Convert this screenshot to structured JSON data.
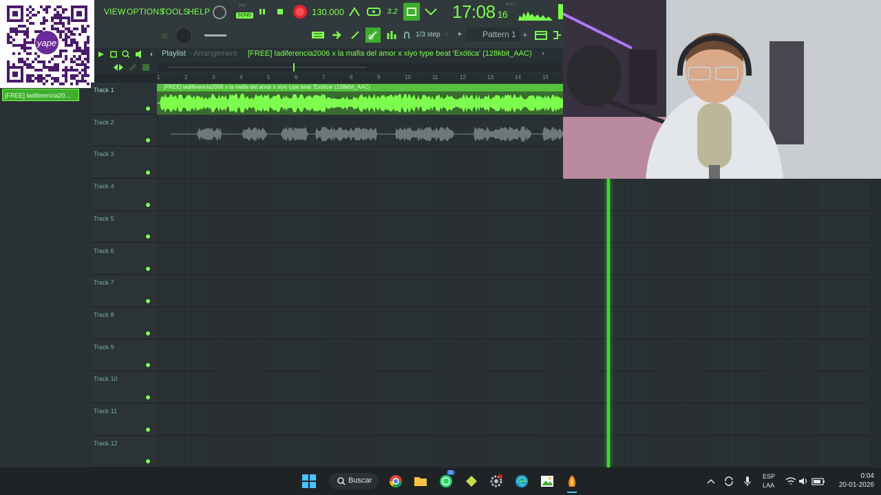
{
  "menu": [
    "VIEW",
    "OPTIONS",
    "TOOLS",
    "HELP"
  ],
  "transport": {
    "pat_label": "PAT",
    "song_label": "SONG",
    "bpm": "130.000",
    "time": "17:08",
    "time_small": "16",
    "bst_label": "B:S:T"
  },
  "toolbar2": {
    "snap": "1/3 step",
    "pattern": "Pattern 1",
    "pattern_add": "+"
  },
  "playlist": {
    "title": "Playlist",
    "subtitle": "Arrangement",
    "separator": "›",
    "clip_name": "[FREE] ladiferencia2006 x la mafia del amor x xiyo type beat 'Exótica' (128kbit_AAC)"
  },
  "browser": {
    "selected_pattern": "[FREE] ladiferencia20..."
  },
  "ruler_ticks": [
    "1",
    "2",
    "3",
    "4",
    "5",
    "6",
    "7",
    "8",
    "9",
    "10",
    "11",
    "12",
    "13",
    "14",
    "15"
  ],
  "tracks": [
    "Track 1",
    "Track 2",
    "Track 3",
    "Track 4",
    "Track 5",
    "Track 6",
    "Track 7",
    "Track 8",
    "Track 9",
    "Track 10",
    "Track 11",
    "Track 12"
  ],
  "clip_track1_label": "[FREE] ladiferencia2006 x la mafia del amor x xiyo type beat 'Exótica' (128kbit_AAC)",
  "taskbar": {
    "search": "Buscar",
    "lang_top": "ESP",
    "lang_bottom": "LAA",
    "clock_time": "0:04",
    "clock_date": "20-01-2026",
    "whatsapp_badge": "31"
  },
  "qr_brand": "yape",
  "colors": {
    "accent": "#7dff4d",
    "background": "#22282b",
    "panel": "#31393c",
    "playhead": "#3ddc2e",
    "clip": "#3fae2e"
  },
  "icons": [
    "metronome-icon",
    "wait-icon",
    "countdown-icon",
    "loop-record-icon",
    "step-edit-icon",
    "snap-icon",
    "pattern-icon",
    "mixer-icon",
    "search-icon",
    "windows-icon",
    "chrome-icon",
    "folder-icon",
    "whatsapp-icon",
    "fl-studio-icon",
    "edge-icon",
    "photos-icon",
    "wifi-icon",
    "speaker-icon",
    "battery-icon",
    "chevron-up-icon",
    "mic-icon",
    "sync-icon"
  ]
}
